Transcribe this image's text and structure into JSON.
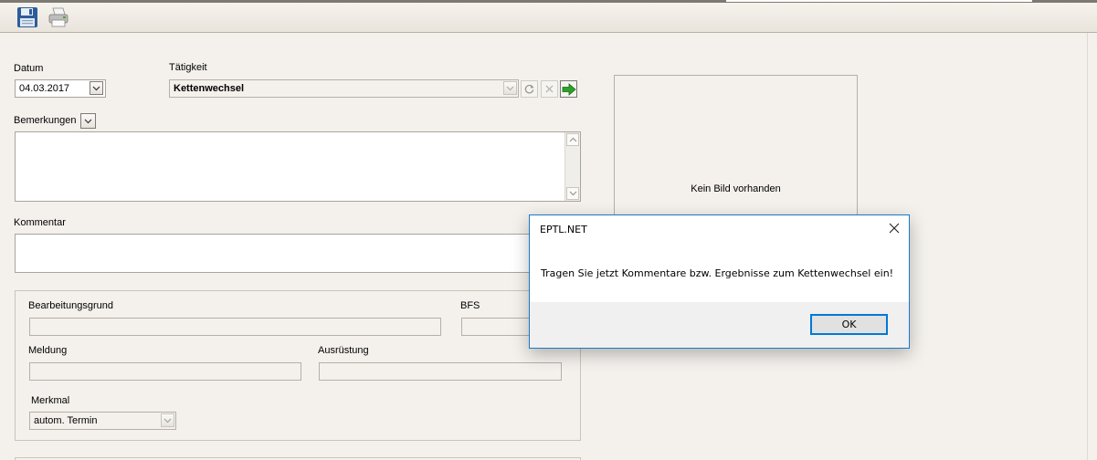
{
  "toolbar": {
    "save_icon": "floppy-disk-icon",
    "print_icon": "printer-icon"
  },
  "form": {
    "datum": {
      "label": "Datum",
      "value": "04.03.2017"
    },
    "taetigkeit": {
      "label": "Tätigkeit",
      "value": "Kettenwechsel"
    },
    "bemerkungen": {
      "label": "Bemerkungen",
      "value": ""
    },
    "kommentar": {
      "label": "Kommentar",
      "value": ""
    },
    "bearbeitungsgrund": {
      "label": "Bearbeitungsgrund",
      "value": ""
    },
    "bfs": {
      "label": "BFS",
      "value": ""
    },
    "meldung": {
      "label": "Meldung",
      "value": ""
    },
    "ausruestung": {
      "label": "Ausrüstung",
      "value": ""
    },
    "merkmal": {
      "label": "Merkmal",
      "value": "autom. Termin"
    }
  },
  "image_panel": {
    "text": "Kein Bild vorhanden"
  },
  "dialog": {
    "title": "EPTL.NET",
    "message": "Tragen Sie jetzt Kommentare bzw. Ergebnisse zum Kettenwechsel ein!",
    "ok_label": "OK"
  },
  "colors": {
    "background": "#f4f1ec",
    "dialog_border": "#1979ca",
    "ok_focus": "#0078d7",
    "go_arrow": "#2ca12c"
  }
}
